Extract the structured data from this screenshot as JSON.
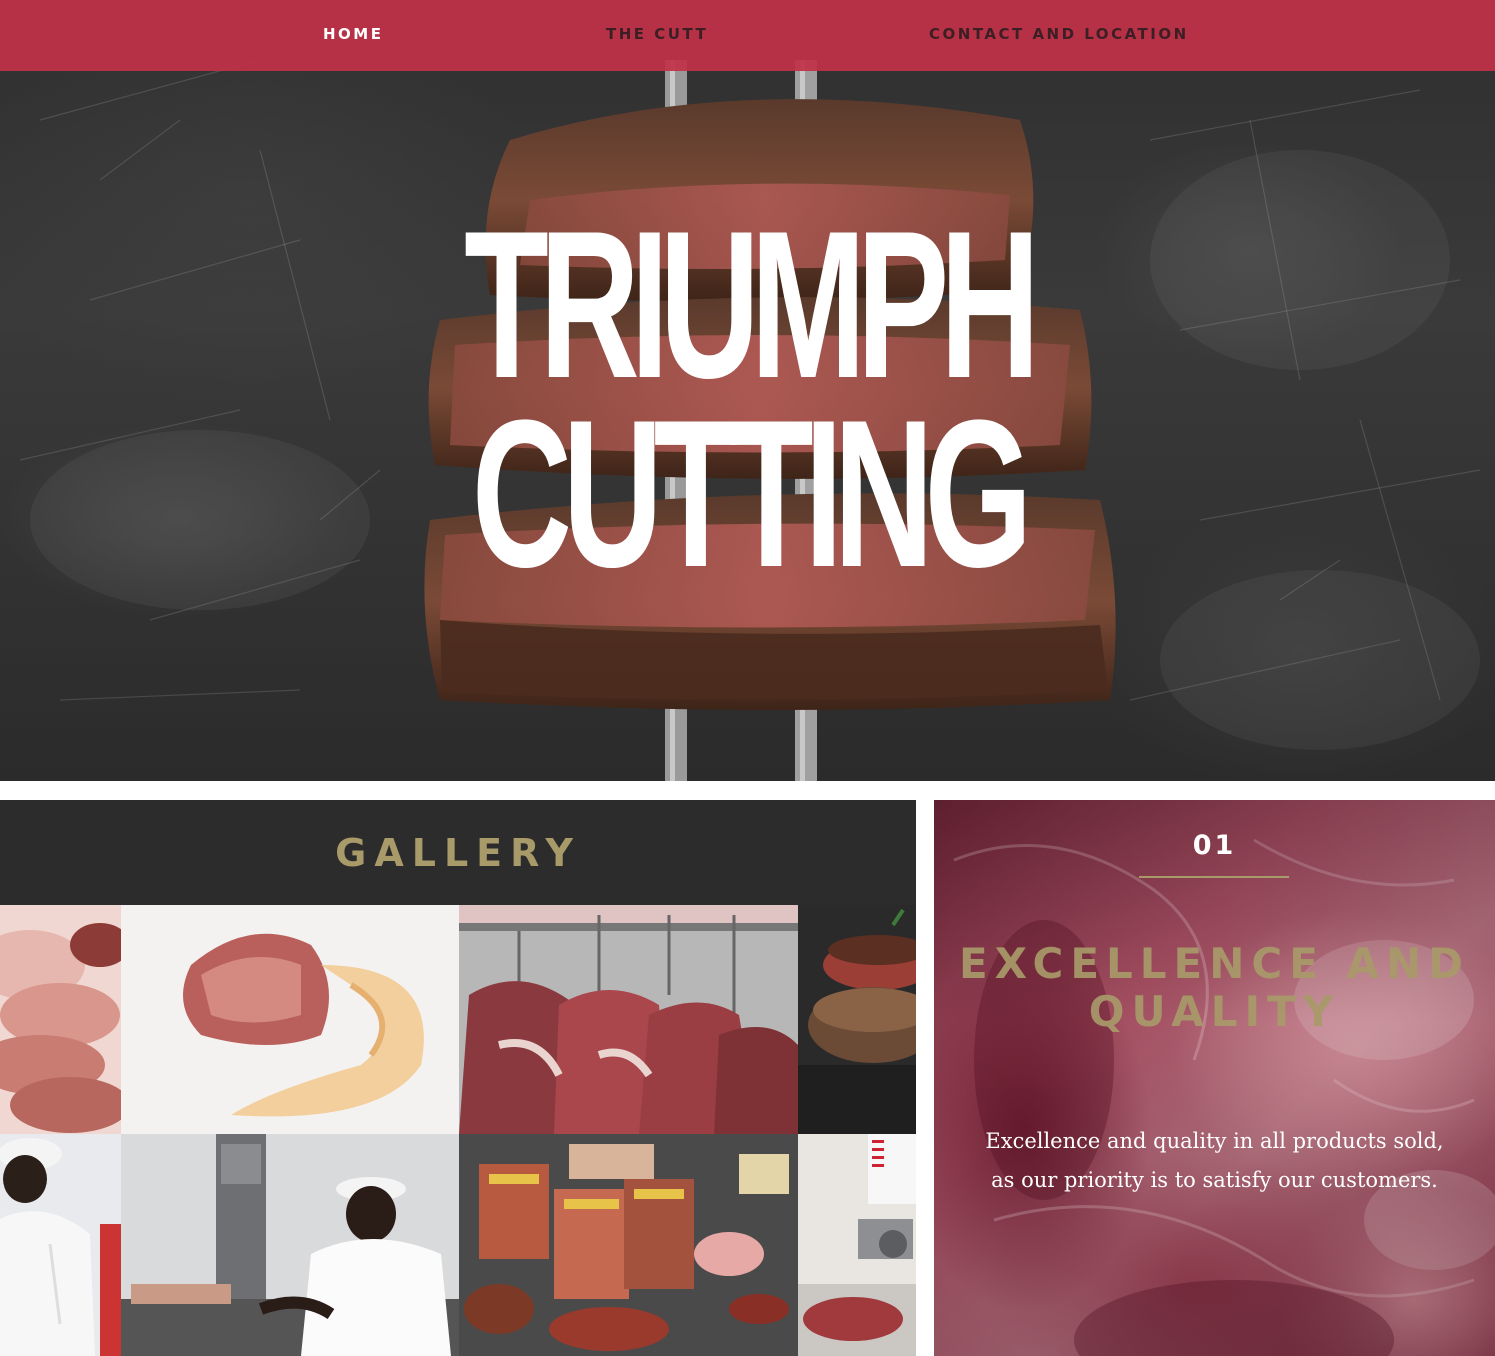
{
  "nav": {
    "items": [
      {
        "label": "HOME",
        "active": true
      },
      {
        "label": "THE CUTT",
        "active": false
      },
      {
        "label": "CONTACT AND LOCATION",
        "active": false
      }
    ]
  },
  "hero": {
    "title_line1": "TRIUMPH",
    "title_line2": "CUTTING"
  },
  "gallery": {
    "title": "GALLERY"
  },
  "feature": {
    "number": "01",
    "heading": "EXCELLENCE AND QUALITY",
    "text": "Excellence and quality in all products sold, as our priority is to satisfy our customers."
  },
  "colors": {
    "nav_bg": "#c13248",
    "gold": "#a99a6a",
    "gallery_header_bg": "#2c2c2c"
  }
}
